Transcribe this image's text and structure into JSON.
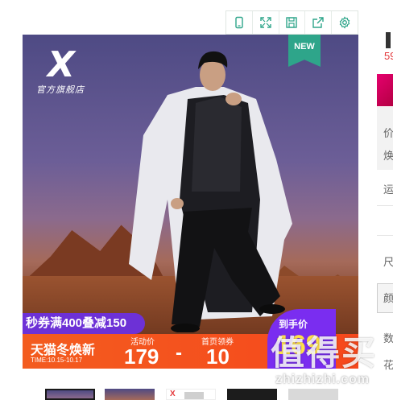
{
  "toolbar": {
    "buttons": [
      {
        "icon": "phone-icon"
      },
      {
        "icon": "expand-icon"
      },
      {
        "icon": "save-icon"
      },
      {
        "icon": "share-icon"
      },
      {
        "icon": "gear-icon"
      }
    ],
    "accent": "#2ea58a"
  },
  "hero": {
    "logo_text": "官方旗舰店",
    "badge": "NEW"
  },
  "promo": {
    "coupon": "秒券满400叠减150",
    "title": "天猫冬焕新",
    "time": "TIME:10.15-10.17",
    "activity_label": "活动价",
    "activity_value": "179",
    "dash": "-",
    "coupon_label": "首页领券",
    "coupon_value": "10",
    "final_label": "到手价",
    "final_value": "169",
    "colors": {
      "strip": "#f35c1f",
      "coupon": "#6d31d6",
      "final": "#7a2df0"
    }
  },
  "sidebar": {
    "price_partial": "59",
    "labels": [
      "价",
      "焕",
      "运",
      "尺",
      "颜",
      "数",
      "花"
    ]
  },
  "watermark": {
    "big": "值得买",
    "small": "zhizhizhi.com"
  },
  "thumbnails": [
    {
      "name": "thumb-1",
      "active": true
    },
    {
      "name": "thumb-2",
      "active": false
    },
    {
      "name": "thumb-3",
      "active": false
    },
    {
      "name": "thumb-4",
      "active": false
    },
    {
      "name": "thumb-5",
      "active": false
    }
  ]
}
